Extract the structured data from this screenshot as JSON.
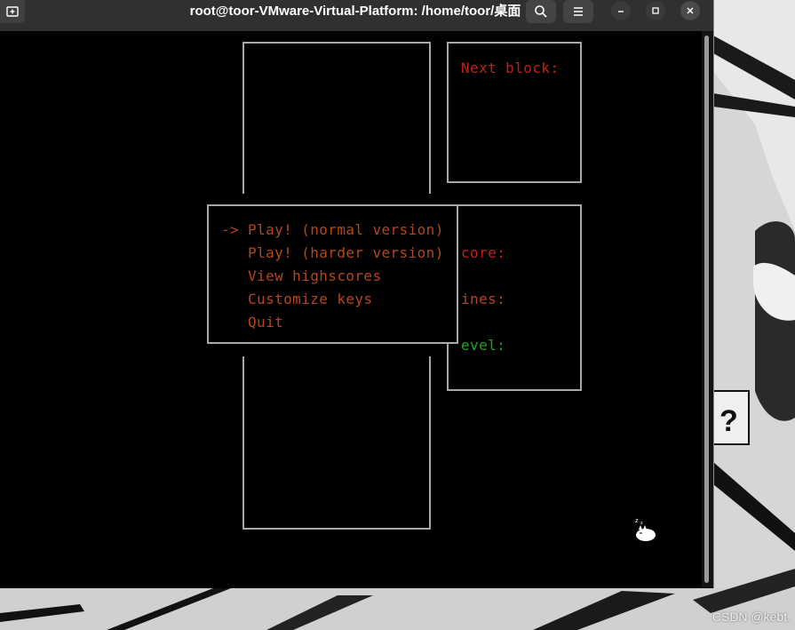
{
  "window": {
    "title": "root@toor-VMware-Virtual-Platform: /home/toor/桌面"
  },
  "icons": {
    "new_tab": "new-tab-icon",
    "search": "search-icon",
    "menu": "hamburger-menu-icon",
    "minimize": "minimize-icon",
    "maximize": "maximize-icon",
    "close": "close-icon"
  },
  "game": {
    "next_block_label": "Next block:",
    "score_label": "core:",
    "lines_label": "ines:",
    "level_label": "evel:"
  },
  "menu": {
    "cursor": "->",
    "items": [
      "Play! (normal version)",
      "Play! (harder version)",
      "View highscores",
      "Customize keys",
      "Quit"
    ]
  },
  "colors": {
    "terminal_bg": "#000000",
    "box_border": "#a8a8a8",
    "menu_text": "#b5461b",
    "next_label": "#c0201a",
    "score_label": "#c0201a",
    "lines_label": "#b5461b",
    "level_label": "#22a326"
  },
  "watermark": "CSDN @kebt."
}
